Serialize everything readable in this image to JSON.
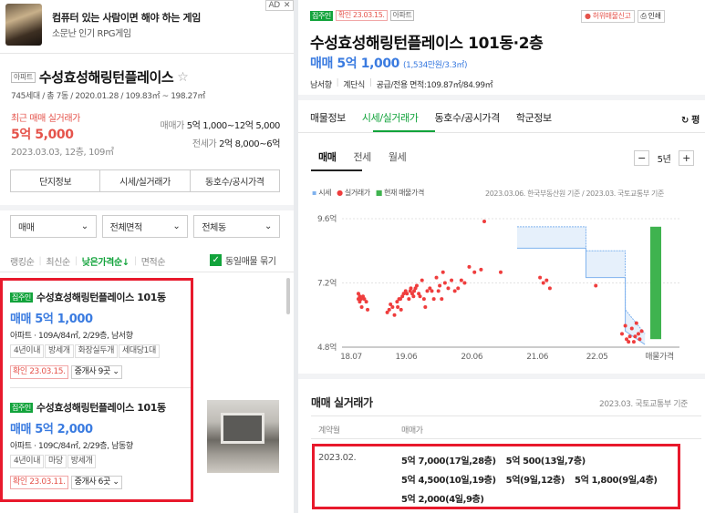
{
  "ad": {
    "title": "컴퓨터 있는 사람이면 해야 하는 게임",
    "subtitle": "소문난 인기 RPG게임",
    "badge": "AD",
    "close": "✕"
  },
  "complex": {
    "type_chip": "아파트",
    "name": "수성효성해링턴플레이스",
    "star": "☆",
    "info": "745세대 / 총 7동 / 2020.01.28 / 109.83㎡ ~ 198.27㎡"
  },
  "price_summary": {
    "recent_label": "최근 매매 실거래가",
    "recent_price": "5억 5,000",
    "recent_date": "2023.03.03, 12층, 109㎡",
    "sale_label": "매매가",
    "sale_range": "5억 1,000~12억 5,000",
    "jeonse_label": "전세가",
    "jeonse_range": "2억 8,000~6억"
  },
  "left_tabs": [
    "단지정보",
    "시세/실거래가",
    "동호수/공시가격"
  ],
  "filters": [
    "매매",
    "전체면적",
    "전체동"
  ],
  "sort": {
    "options": [
      "랭킹순",
      "최신순",
      "낮은가격순↓",
      "면적순"
    ],
    "check_label": "동일매물 묶기"
  },
  "listings": [
    {
      "tag": "집주인",
      "title": "수성효성해링턴플레이스 101동",
      "price": "매매 5억 1,000",
      "detail": "아파트 · 109A/84㎡, 2/29층, 남서향",
      "features": [
        "4년이내",
        "방세개",
        "화장실두개",
        "세대당1대"
      ],
      "confirm": "확인 23.03.15.",
      "agents": "중개사 9곳"
    },
    {
      "tag": "집주인",
      "title": "수성효성해링턴플레이스 101동",
      "price": "매매 5억 2,000",
      "detail": "아파트 · 109C/84㎡, 2/29층, 남동향",
      "features": [
        "4년이내",
        "마당",
        "방세개"
      ],
      "confirm": "확인 23.03.11.",
      "agents": "중개사 6곳"
    }
  ],
  "detail": {
    "tag": "집주인",
    "confirm": "확인 23.03.15.",
    "type_chip": "아파트",
    "report": "허위매물신고",
    "print": "인쇄",
    "title": "수성효성해링턴플레이스 101동·2층",
    "price": "매매 5억 1,000",
    "price_sub": "(1,534만원/3.3㎡)",
    "info": [
      "남서향",
      "계단식",
      "공급/전용 면적:109.87㎡/84.99㎡"
    ]
  },
  "detail_tabs": [
    "매물정보",
    "시세/실거래가",
    "동호수/공시가격",
    "학군정보",
    "평"
  ],
  "trade_tabs": [
    "매매",
    "전세",
    "월세"
  ],
  "period": {
    "minus": "−",
    "value": "5년",
    "plus": "+"
  },
  "legend": {
    "items": [
      "시세",
      "실거래가",
      "현재 매물가격"
    ],
    "source": "2023.03.06. 한국부동산원 기준 / 2023.03. 국토교통부 기준"
  },
  "colors": {
    "accent_blue": "#3a7be0",
    "dot_red": "#ef3d3d",
    "listing_green": "#12a33b",
    "highlight_red": "#e8192c"
  },
  "chart_data": {
    "type": "scatter",
    "y_ticks": [
      "9.6억",
      "7.2억",
      "4.8억"
    ],
    "x_ticks": [
      "18.07",
      "19.06",
      "20.06",
      "21.06",
      "22.05",
      "매물가격"
    ],
    "ylim": [
      4.8,
      9.6
    ],
    "ylabel": "억",
    "series": [
      {
        "name": "실거래가",
        "x": [
          2018.83,
          2018.83,
          2018.85,
          2018.85,
          2018.87,
          2018.88,
          2018.9,
          2018.92,
          2018.95,
          2018.97,
          2019.27,
          2019.3,
          2019.32,
          2019.35,
          2019.38,
          2019.42,
          2019.43,
          2019.45,
          2019.47,
          2019.48,
          2019.5,
          2019.52,
          2019.55,
          2019.57,
          2019.6,
          2019.62,
          2019.63,
          2019.65,
          2019.67,
          2019.68,
          2019.7,
          2019.72,
          2019.75,
          2019.77,
          2019.8,
          2019.83,
          2019.85,
          2019.88,
          2019.92,
          2019.95,
          2019.98,
          2020.02,
          2020.05,
          2020.07,
          2020.1,
          2020.12,
          2020.15,
          2020.2,
          2020.25,
          2020.3,
          2020.35,
          2020.4,
          2020.45,
          2020.52,
          2020.6,
          2020.7,
          2020.75,
          2021.0,
          2021.6,
          2021.65,
          2021.7,
          2021.75,
          2022.45,
          2022.85,
          2022.9,
          2022.92,
          2022.95,
          2022.97,
          2023.0,
          2023.03,
          2023.05,
          2023.07,
          2023.1,
          2023.12,
          2023.15
        ],
        "y": [
          6.8,
          6.6,
          6.7,
          6.5,
          6.6,
          6.3,
          6.7,
          6.6,
          6.5,
          6.2,
          6.1,
          6.2,
          6.4,
          6.3,
          6.0,
          6.5,
          6.3,
          6.6,
          6.6,
          6.2,
          6.7,
          6.8,
          6.9,
          6.8,
          6.6,
          6.9,
          7.0,
          6.8,
          6.7,
          6.9,
          7.0,
          7.1,
          6.8,
          6.7,
          7.3,
          6.6,
          6.3,
          6.9,
          7.0,
          6.9,
          6.6,
          7.4,
          6.9,
          7.1,
          6.6,
          7.6,
          7.2,
          7.0,
          7.3,
          6.9,
          7.0,
          7.3,
          7.2,
          7.8,
          7.6,
          7.7,
          9.5,
          7.6,
          7.4,
          7.2,
          7.3,
          7.0,
          7.1,
          5.3,
          5.6,
          5.1,
          5.0,
          5.2,
          5.5,
          5.0,
          5.2,
          5.7,
          5.3,
          5.1,
          5.4
        ]
      },
      {
        "name": "시세",
        "x": [
          2021.25,
          2022.3,
          2022.3,
          2022.9,
          2022.9,
          2023.2
        ],
        "y_high": [
          9.3,
          9.3,
          8.4,
          8.4,
          6.2,
          5.3
        ],
        "y_low": [
          8.5,
          8.5,
          7.4,
          7.4,
          5.4,
          4.9
        ]
      },
      {
        "name": "현재 매물가격",
        "low": 5.1,
        "high": 9.3
      }
    ]
  },
  "trade_list": {
    "title": "매매 실거래가",
    "source": "2023.03. 국토교통부 기준",
    "col1": "계약월",
    "col2": "매매가",
    "month": "2023.02.",
    "rows": [
      [
        "5억 7,000(17일,28층)",
        "5억 500(13일,7층)"
      ],
      [
        "5억 4,500(10일,19층)",
        "5억(9일,12층)",
        "5억 1,800(9일,4층)"
      ],
      [
        "5억 2,000(4일,9층)"
      ]
    ]
  }
}
